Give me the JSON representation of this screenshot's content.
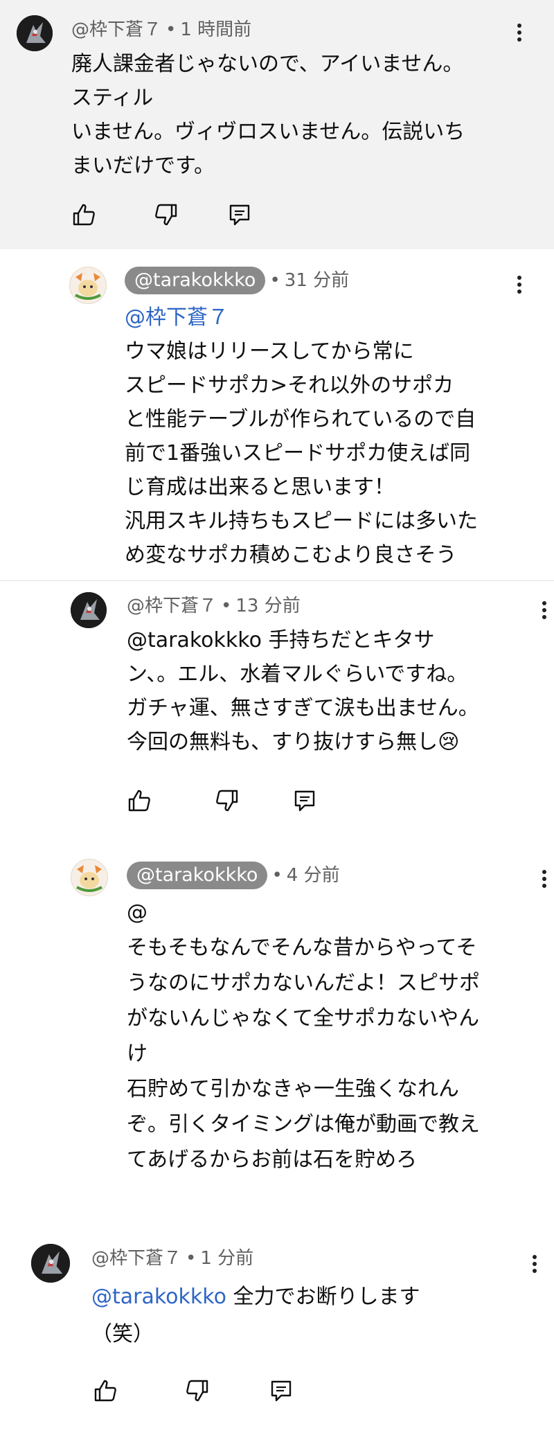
{
  "comments": [
    {
      "author": "@枠下蒼７",
      "time": "1 時間前",
      "lines": [
        "廃人課金者じゃないので、アイいません。",
        "スティル",
        "いません。ヴィヴロスいません。伝説いち",
        "まいだけです。"
      ]
    },
    {
      "author": "@tarakokkko",
      "time": "31 分前",
      "mention": "@枠下蒼７",
      "lines": [
        "ウマ娘はリリースしてから常に",
        "スピードサポカ>それ以外のサポカ",
        "と性能テーブルが作られているので自",
        "前で1番強いスピードサポカ使えば同",
        "じ育成は出来ると思います！",
        "汎用スキル持ちもスピードには多いた",
        "め変なサポカ積めこむより良さそう"
      ]
    },
    {
      "author": "@枠下蒼７",
      "time": "13 分前",
      "lines": [
        "@tarakokkko  手持ちだとキタサ",
        "ン、。エル、水着マルぐらいですね。",
        "ガチャ運、無さすぎて涙も出ません。",
        "今回の無料も、すり抜けすら無し"
      ],
      "emoji": "😢"
    },
    {
      "author": "@tarakokkko",
      "time": "4 分前",
      "lines": [
        "@",
        "そもそもなんでそんな昔からやってそ",
        "うなのにサポカないんだよ！スピサポ",
        "がないんじゃなくて全サポカないやん",
        "け",
        "石貯めて引かなきゃ一生強くなれん",
        "ぞ。引くタイミングは俺が動画で教え",
        "てあげるからお前は石を貯めろ"
      ]
    },
    {
      "author": "@枠下蒼７",
      "time": "1 分前",
      "mention": "@tarakokkko",
      "text_after_mention": " 全力でお断りします",
      "lines": [
        "（笑）"
      ]
    }
  ],
  "separator": "•",
  "icons": [
    "like-icon",
    "dislike-icon",
    "reply-icon",
    "more-vert-icon",
    "avatar-robot",
    "avatar-cat"
  ]
}
